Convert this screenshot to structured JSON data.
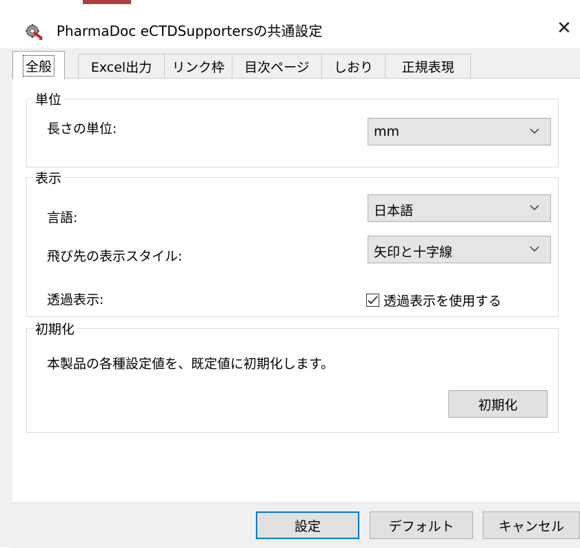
{
  "window": {
    "title": "PharmaDoc eCTDSupportersの共通設定",
    "close_glyph": "✕"
  },
  "tabs": [
    {
      "label": "全般",
      "active": true
    },
    {
      "label": "Excel出力",
      "active": false
    },
    {
      "label": "リンク枠",
      "active": false
    },
    {
      "label": "目次ページ",
      "active": false
    },
    {
      "label": "しおり",
      "active": false
    },
    {
      "label": "正規表現",
      "active": false
    }
  ],
  "unit_group": {
    "title": "単位",
    "length_label": "長さの単位:",
    "length_value": "mm"
  },
  "display_group": {
    "title": "表示",
    "language_label": "言語:",
    "language_value": "日本語",
    "dest_style_label": "飛び先の表示スタイル:",
    "dest_style_value": "矢印と十字線",
    "transparent_label": "透過表示:",
    "transparent_checkbox_label": "透過表示を使用する",
    "transparent_checked": true
  },
  "init_group": {
    "title": "初期化",
    "description": "本製品の各種設定値を、既定値に初期化します。",
    "init_button": "初期化"
  },
  "footer": {
    "ok_button": "設定",
    "default_button": "デフォルト",
    "cancel_button": "キャンセル"
  },
  "icons": {
    "app": "gear-with-red-arrow-icon",
    "dropdown": "chevron-down-icon",
    "check": "checkmark-icon"
  }
}
